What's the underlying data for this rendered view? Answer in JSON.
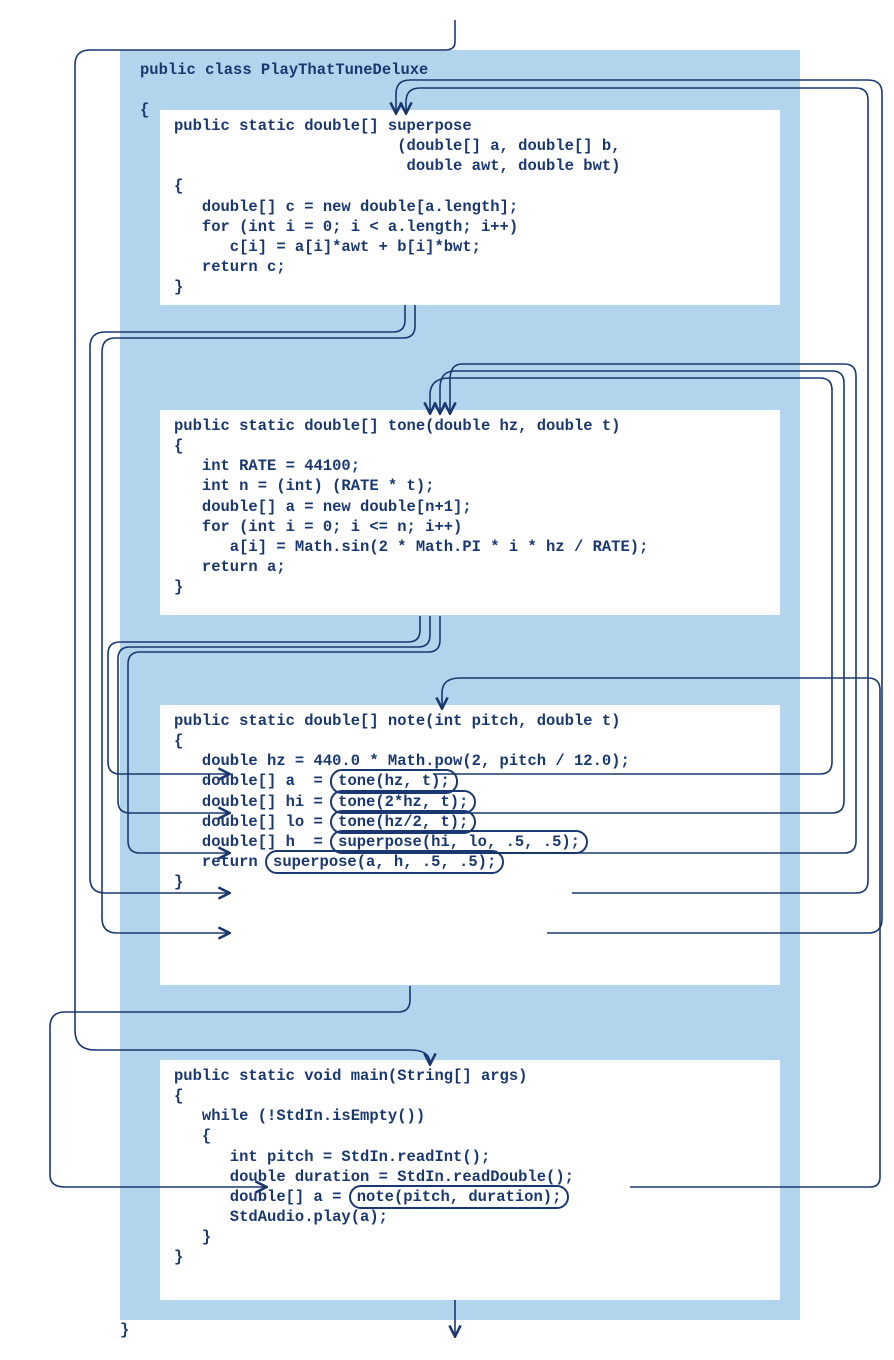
{
  "class": {
    "decl": "public class PlayThatTuneDeluxe",
    "open": "{",
    "close": "}"
  },
  "methods": {
    "superpose": {
      "sig1": "public static double[] superpose",
      "sig2": "                        (double[] a, double[] b,",
      "sig3": "                         double awt, double bwt)",
      "body": "{\n   double[] c = new double[a.length];\n   for (int i = 0; i < a.length; i++)\n      c[i] = a[i]*awt + b[i]*bwt;\n   return c;\n}"
    },
    "tone": {
      "sig": "public static double[] tone(double hz, double t)",
      "body": "{\n   int RATE = 44100;\n   int n = (int) (RATE * t);\n   double[] a = new double[n+1];\n   for (int i = 0; i <= n; i++)\n      a[i] = Math.sin(2 * Math.PI * i * hz / RATE);\n   return a;\n}"
    },
    "note": {
      "sig": "public static double[] note(int pitch, double t)",
      "l1": "{",
      "l2": "   double hz = 440.0 * Math.pow(2, pitch / 12.0);",
      "l3a": "   double[] a  = ",
      "l3b": "tone(hz, t);",
      "l4": "",
      "l5a": "   double[] hi = ",
      "l5b": "tone(2*hz, t);",
      "l6": "",
      "l7a": "   double[] lo = ",
      "l7b": "tone(hz/2, t);",
      "l8": "",
      "l9a": "   double[] h  = ",
      "l9b": "superpose(hi, lo, .5, .5);",
      "l10": "",
      "l11a": "   return ",
      "l11b": "superpose(a, h, .5, .5);",
      "l12": "",
      "l13": "}"
    },
    "main": {
      "sig": "public static void main(String[] args)",
      "l1": "{",
      "l2": "   while (!StdIn.isEmpty())",
      "l3": "   {",
      "l4": "      int pitch = StdIn.readInt();",
      "l5": "      double duration = StdIn.readDouble();",
      "l6a": "      double[] a = ",
      "l6b": "note(pitch, duration);",
      "l7": "",
      "l8": "      StdAudio.play(a);",
      "l9": "   }",
      "l10": "}"
    }
  },
  "flows": [
    {
      "desc": "entry to main",
      "from": "top",
      "to": "main.sig"
    },
    {
      "desc": "note call -> note decl",
      "from": "main.noteCall",
      "to": "note.sig"
    },
    {
      "desc": "tone(hz,t) -> tone decl",
      "from": "note.toneA",
      "to": "tone.sig"
    },
    {
      "desc": "tone(2hz,t) -> tone decl",
      "from": "note.toneHi",
      "to": "tone.sig"
    },
    {
      "desc": "tone(hz/2,t) -> tone decl",
      "from": "note.toneLo",
      "to": "tone.sig"
    },
    {
      "desc": "superpose(hi,lo) -> superpose decl",
      "from": "note.sup1",
      "to": "superpose.sig"
    },
    {
      "desc": "superpose(a,h) -> superpose decl",
      "from": "note.sup2",
      "to": "superpose.sig"
    },
    {
      "desc": "superpose return -> h assignment",
      "from": "superpose.ret",
      "to": "note.hAssign"
    },
    {
      "desc": "superpose return -> return line",
      "from": "superpose.ret",
      "to": "note.retLine"
    },
    {
      "desc": "tone return -> a",
      "from": "tone.ret",
      "to": "note.aAssign"
    },
    {
      "desc": "tone return -> hi",
      "from": "tone.ret",
      "to": "note.hiAssign"
    },
    {
      "desc": "tone return -> lo",
      "from": "tone.ret",
      "to": "note.loAssign"
    },
    {
      "desc": "note return -> a in main",
      "from": "note.ret",
      "to": "main.aAssign"
    },
    {
      "desc": "main exit",
      "from": "main.end",
      "to": "bottom"
    }
  ]
}
